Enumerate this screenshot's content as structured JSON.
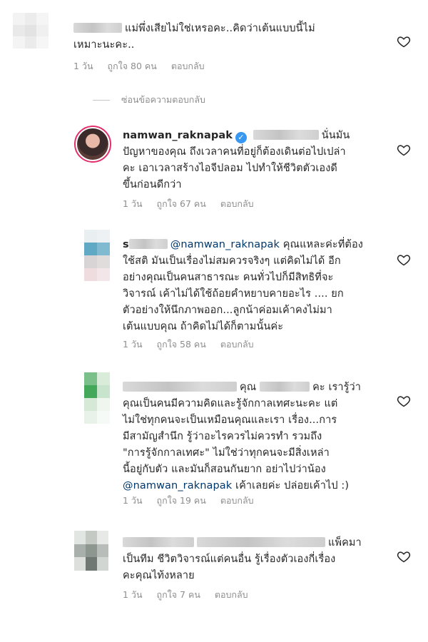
{
  "comments": [
    {
      "text": "แม่พึ่งเสียไม่ใช่เหรอคะ..คิดว่าเต้นแบบนี้ไม่เหมาะนะคะ..",
      "line1": "แม่พึ่งเสียไม่ใช่เหรอคะ..คิดว่าเต้นแบบนี้ไม่",
      "line2": "เหมาะนะคะ..",
      "time": "1 วัน",
      "likes": "ถูกใจ 80 คน",
      "reply": "ตอบกลับ"
    },
    {
      "username": "namwan_raknapak",
      "line1": "นั่นมัน",
      "lines": [
        "ปัญหาของคุณ ถึงเวลาคนที่อยู่ก็ต้องเดินต่อไปเปล่า",
        "คะ เอาเวลาสร้างไอจีปลอม ไปทำให้ชีวิตตัวเองดี",
        "ขึ้นก่อนดีกว่า"
      ],
      "time": "1 วัน",
      "likes": "ถูกใจ 67 คน",
      "reply": "ตอบกลับ"
    },
    {
      "username_prefix": "s",
      "mention": "@namwan_raknapak",
      "line1": "คุณแหละค่ะที่ต้อง",
      "lines": [
        "ใช้สติ มันเป็นเรื่องไม่สมควรจริงๆ แต่คิดไม่ได้ อีก",
        "อย่างคุณเป็นคนสาธารณะ คนทั่วไปก็มีสิทธิที่จะ",
        "วิจารณ์ เค้าไม่ได้ใช้ถ้อยคำหยาบคายอะไร .... ยก",
        "ตัวอย่างให้นึกภาพออก...ลูกน้าค่อมเค้าคงไม่มา",
        "เต้นแบบคุณ ถ้าคิดไม่ได้ก็ตามนั้นค่ะ"
      ],
      "time": "1 วัน",
      "likes": "ถูกใจ 58 คน",
      "reply": "ตอบกลับ"
    },
    {
      "line1a": "คุณ",
      "line1b": "คะ เรารู้ว่า",
      "lines": [
        "คุณเป็นคนมีความคิดและรู้จักกาลเทศะนะคะ แต่",
        "ไม่ใช่ทุกคนจะเป็นเหมือนคุณและเรา เรื่อง...การ",
        "มีสามัญสำนึก รู้ว่าอะไรควรไม่ควรทำ รวมถึง",
        "\"การรู้จักกาลเทศะ\" ไม่ใช่ว่าทุกคนจะมีสิ่งเหล่า",
        "นี้อยู่กับตัว และมันก็สอนกันยาก อย่าไปว่าน้อง"
      ],
      "mention": "@namwan_raknapak",
      "last": "เค้าเลยค่ะ ปล่อยเค้าไป :)",
      "time": "1 วัน",
      "likes": "ถูกใจ 19 คน",
      "reply": "ตอบกลับ"
    },
    {
      "line1": "แพ็คมา",
      "lines": [
        "เป็นทีม ชีวิตวิจารณ์แต่คนอื่น รู้เรื่องตัวเองกี่เรื่อง",
        "คะคุณไท้งหลาย"
      ],
      "time": "1 วัน",
      "likes": "ถูกใจ 7 คน",
      "reply": "ตอบกลับ"
    }
  ],
  "hide_replies": "ซ่อนข้อความตอบกลับ",
  "icons": {
    "like": "heart-outline-icon",
    "verified": "verified-badge-icon"
  },
  "colors": {
    "mention": "#00376b",
    "meta": "#8e8e8e",
    "verified": "#3897f0"
  }
}
